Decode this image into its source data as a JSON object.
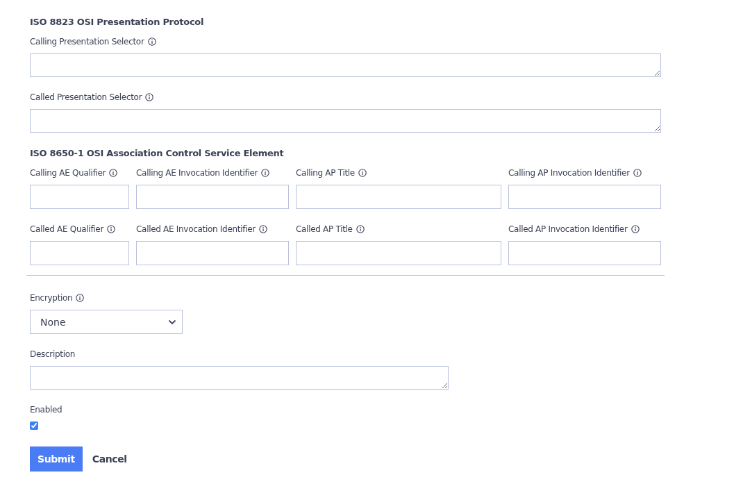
{
  "sections": [
    {
      "title": "ISO 8823 OSI Presentation Protocol",
      "kind": "stack",
      "fields": [
        {
          "label": "Calling Presentation Selector",
          "info": true,
          "kind": "textarea"
        },
        {
          "label": "Called Presentation Selector",
          "info": true,
          "kind": "textarea"
        }
      ]
    },
    {
      "title": "ISO 8650-1 OSI Association Control Service Element",
      "kind": "grid",
      "fields": [
        {
          "label": "Calling AE Qualifier",
          "info": true,
          "kind": "input"
        },
        {
          "label": "Calling AE Invocation Identifier",
          "info": true,
          "kind": "input"
        },
        {
          "label": "Calling AP Title",
          "info": true,
          "kind": "input"
        },
        {
          "label": "Calling AP Invocation Identifier",
          "info": true,
          "kind": "input"
        },
        {
          "label": "Called AE Qualifier",
          "info": true,
          "kind": "input"
        },
        {
          "label": "Called AE Invocation Identifier",
          "info": true,
          "kind": "input"
        },
        {
          "label": "Called AP Title",
          "info": true,
          "kind": "input"
        },
        {
          "label": "Called AP Invocation Identifier",
          "info": true,
          "kind": "input"
        }
      ]
    }
  ],
  "encryption": {
    "label": "Encryption",
    "info": true,
    "value": "None"
  },
  "description": {
    "label": "Description"
  },
  "enabled": {
    "label": "Enabled",
    "checked": true
  },
  "buttons": [
    {
      "label": "Submit",
      "kind": "primary"
    },
    {
      "label": "Cancel",
      "kind": "link"
    }
  ]
}
